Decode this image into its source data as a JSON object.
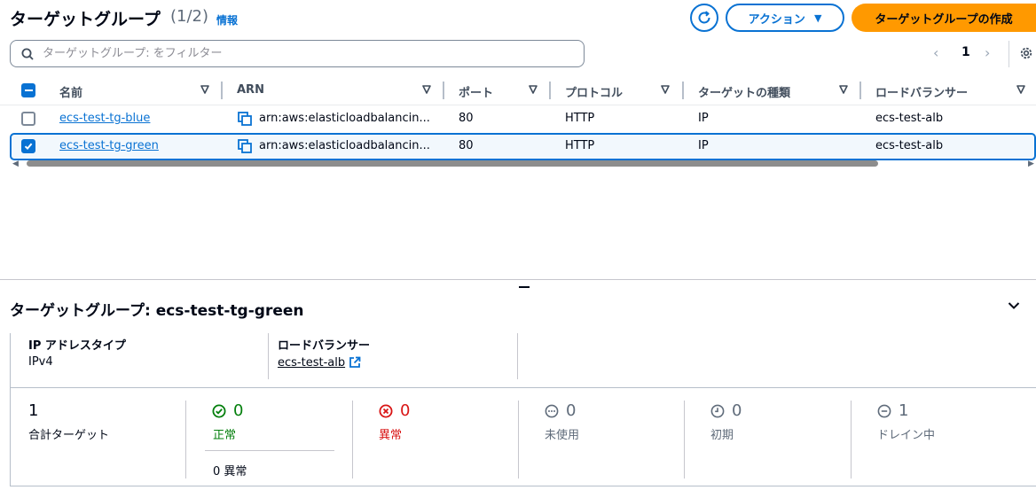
{
  "header": {
    "title": "ターゲットグループ",
    "count": "(1/2)",
    "info_link": "情報",
    "action_label": "アクション",
    "create_label": "ターゲットグループの作成"
  },
  "filter": {
    "placeholder": "ターゲットグループ: をフィルター"
  },
  "pagination": {
    "current_page": "1"
  },
  "table": {
    "columns": [
      "名前",
      "ARN",
      "ポート",
      "プロトコル",
      "ターゲットの種類",
      "ロードバランサー"
    ],
    "rows": [
      {
        "name": "ecs-test-tg-blue",
        "arn": "arn:aws:elasticloadbalancin...",
        "port": "80",
        "protocol": "HTTP",
        "target_type": "IP",
        "load_balancer": "ecs-test-alb",
        "selected": false
      },
      {
        "name": "ecs-test-tg-green",
        "arn": "arn:aws:elasticloadbalancin...",
        "port": "80",
        "protocol": "HTTP",
        "target_type": "IP",
        "load_balancer": "ecs-test-alb",
        "selected": true
      }
    ]
  },
  "details": {
    "title": "ターゲットグループ: ecs-test-tg-green",
    "ip_address_type_label": "IP アドレスタイプ",
    "ip_address_type_value": "IPv4",
    "load_balancer_label": "ロードバランサー",
    "load_balancer_value": "ecs-test-alb"
  },
  "stats": {
    "total": {
      "value": "1",
      "label": "合計ターゲット"
    },
    "healthy": {
      "value": "0",
      "label": "正常",
      "sub": "0 異常"
    },
    "unhealthy": {
      "value": "0",
      "label": "異常"
    },
    "unused": {
      "value": "0",
      "label": "未使用"
    },
    "initial": {
      "value": "0",
      "label": "初期"
    },
    "draining": {
      "value": "1",
      "label": "ドレイン中"
    }
  },
  "colors": {
    "primary": "#0972d3",
    "create_button": "#ff9900",
    "healthy": "#037f0c",
    "unhealthy": "#d91515",
    "neutral": "#5f6b7a"
  }
}
